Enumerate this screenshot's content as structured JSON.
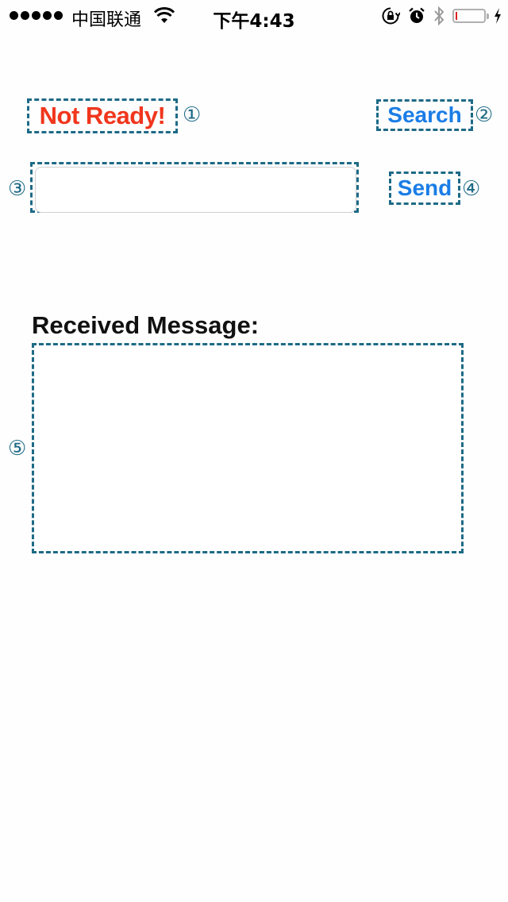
{
  "status_bar": {
    "carrier": "中国联通",
    "time": "下午4:43",
    "battery_level": 0.05,
    "icons": [
      "signal-dots",
      "wifi-icon",
      "rotation-lock-icon",
      "alarm-icon",
      "bluetooth-icon",
      "battery-icon",
      "charging-icon"
    ]
  },
  "main": {
    "status_label": "Not Ready!",
    "search_button": "Search",
    "message_input": {
      "value": "",
      "placeholder": ""
    },
    "send_button": "Send",
    "received_label": "Received Message:",
    "received_text": ""
  },
  "markers": {
    "m1": "①",
    "m2": "②",
    "m3": "③",
    "m4": "④",
    "m5": "⑤"
  },
  "colors": {
    "status_label": "#f0361d",
    "button": "#1a7de6",
    "annotation": "#1d6a86"
  }
}
